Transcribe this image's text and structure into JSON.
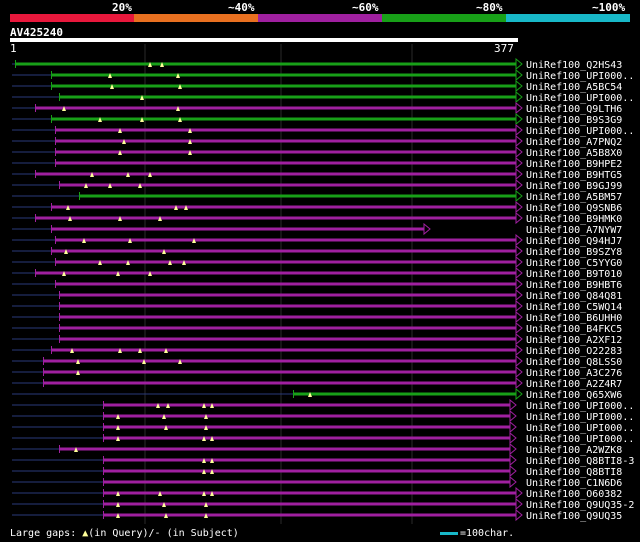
{
  "legend": {
    "segments": [
      {
        "color": "#e8183c"
      },
      {
        "color": "#e87020"
      },
      {
        "color": "#a020a0"
      },
      {
        "color": "#18a018"
      },
      {
        "color": "#18b8c8"
      }
    ],
    "labels": [
      "20%",
      "~40%",
      "~60%",
      "~80%",
      "~100%"
    ]
  },
  "query": {
    "name": "AV425240",
    "start": "1",
    "end": "377"
  },
  "hits": [
    {
      "label": "UniRef100_Q2HS43",
      "color": "green",
      "start": 16,
      "end": 516,
      "tris": [
        150,
        162
      ],
      "arrow": true
    },
    {
      "label": "UniRef100_UPI000..",
      "color": "green",
      "start": 52,
      "end": 516,
      "tris": [
        110,
        178
      ],
      "arrow": true
    },
    {
      "label": "UniRef100_A5BC54",
      "color": "green",
      "start": 52,
      "end": 516,
      "tris": [
        112,
        180
      ],
      "arrow": true
    },
    {
      "label": "UniRef100_UPI000..",
      "color": "green",
      "start": 60,
      "end": 516,
      "tris": [
        142
      ],
      "arrow": true
    },
    {
      "label": "UniRef100_Q9LTH6",
      "color": "purple",
      "start": 36,
      "end": 516,
      "tris": [
        64,
        178
      ],
      "arrow": true
    },
    {
      "label": "UniRef100_B9S3G9",
      "color": "green",
      "start": 52,
      "end": 516,
      "tris": [
        100,
        142,
        180
      ],
      "arrow": true
    },
    {
      "label": "UniRef100_UPI000..",
      "color": "purple",
      "start": 56,
      "end": 516,
      "tris": [
        120,
        190
      ],
      "arrow": true
    },
    {
      "label": "UniRef100_A7PNQ2",
      "color": "purple",
      "start": 56,
      "end": 516,
      "tris": [
        124,
        190
      ],
      "arrow": true
    },
    {
      "label": "UniRef100_A5B8X0",
      "color": "purple",
      "start": 56,
      "end": 516,
      "tris": [
        120,
        190
      ],
      "arrow": true
    },
    {
      "label": "UniRef100_B9HPE2",
      "color": "purple",
      "start": 56,
      "end": 516,
      "tris": [],
      "arrow": true
    },
    {
      "label": "UniRef100_B9HTG5",
      "color": "purple",
      "start": 36,
      "end": 516,
      "tris": [
        92,
        128,
        150
      ],
      "arrow": true
    },
    {
      "label": "UniRef100_B9GJ99",
      "color": "purple",
      "start": 60,
      "end": 516,
      "tris": [
        86,
        110,
        140
      ],
      "arrow": true
    },
    {
      "label": "UniRef100_A5BM57",
      "color": "green",
      "start": 80,
      "end": 516,
      "tris": [],
      "arrow": true
    },
    {
      "label": "UniRef100_Q9SNB6",
      "color": "purple",
      "start": 52,
      "end": 516,
      "tris": [
        68,
        176,
        186
      ],
      "arrow": true
    },
    {
      "label": "UniRef100_B9HMK0",
      "color": "purple",
      "start": 36,
      "end": 516,
      "tris": [
        70,
        120,
        160
      ],
      "arrow": true
    },
    {
      "label": "UniRef100_A7NYW7",
      "color": "purple",
      "start": 52,
      "end": 424,
      "tris": [],
      "arrow": true
    },
    {
      "label": "UniRef100_Q94HJ7",
      "color": "purple",
      "start": 56,
      "end": 516,
      "tris": [
        84,
        130,
        194
      ],
      "arrow": true
    },
    {
      "label": "UniRef100_B9SZY8",
      "color": "purple",
      "start": 52,
      "end": 516,
      "tris": [
        66,
        164
      ],
      "arrow": true
    },
    {
      "label": "UniRef100_C5YYG0",
      "color": "purple",
      "start": 56,
      "end": 516,
      "tris": [
        100,
        128,
        170,
        184
      ],
      "arrow": true
    },
    {
      "label": "UniRef100_B9T010",
      "color": "purple",
      "start": 36,
      "end": 516,
      "tris": [
        64,
        118,
        150
      ],
      "arrow": true
    },
    {
      "label": "UniRef100_B9HBT6",
      "color": "purple",
      "start": 56,
      "end": 516,
      "tris": [],
      "arrow": true
    },
    {
      "label": "UniRef100_Q84Q81",
      "color": "purple",
      "start": 60,
      "end": 516,
      "tris": [],
      "arrow": true
    },
    {
      "label": "UniRef100_C5WQ14",
      "color": "purple",
      "start": 60,
      "end": 516,
      "tris": [],
      "arrow": true
    },
    {
      "label": "UniRef100_B6UHH0",
      "color": "purple",
      "start": 60,
      "end": 516,
      "tris": [],
      "arrow": true
    },
    {
      "label": "UniRef100_B4FKC5",
      "color": "purple",
      "start": 60,
      "end": 516,
      "tris": [],
      "arrow": true
    },
    {
      "label": "UniRef100_A2XF12",
      "color": "purple",
      "start": 60,
      "end": 516,
      "tris": [],
      "arrow": true
    },
    {
      "label": "UniRef100_O22283",
      "color": "purple",
      "start": 52,
      "end": 516,
      "tris": [
        72,
        120,
        140,
        166
      ],
      "arrow": true
    },
    {
      "label": "UniRef100_Q8LSS0",
      "color": "purple",
      "start": 44,
      "end": 516,
      "tris": [
        78,
        144,
        180
      ],
      "arrow": true
    },
    {
      "label": "UniRef100_A3C276",
      "color": "purple",
      "start": 44,
      "end": 516,
      "tris": [
        78
      ],
      "arrow": true
    },
    {
      "label": "UniRef100_A2Z4R7",
      "color": "purple",
      "start": 44,
      "end": 516,
      "tris": [],
      "arrow": true
    },
    {
      "label": "UniRef100_Q65XW6",
      "color": "green",
      "start": 294,
      "end": 516,
      "tris": [
        310
      ],
      "arrow": true
    },
    {
      "label": "UniRef100_UPI000..",
      "color": "purple",
      "start": 104,
      "end": 510,
      "tris": [
        158,
        168,
        204,
        212
      ],
      "arrow": true
    },
    {
      "label": "UniRef100_UPI000..",
      "color": "purple",
      "start": 104,
      "end": 510,
      "tris": [
        118,
        164,
        206
      ],
      "arrow": true
    },
    {
      "label": "UniRef100_UPI000..",
      "color": "purple",
      "start": 104,
      "end": 510,
      "tris": [
        118,
        166,
        206
      ],
      "arrow": true
    },
    {
      "label": "UniRef100_UPI000..",
      "color": "purple",
      "start": 104,
      "end": 510,
      "tris": [
        118,
        204,
        212
      ],
      "arrow": true
    },
    {
      "label": "UniRef100_A2WZK8",
      "color": "purple",
      "start": 60,
      "end": 510,
      "tris": [
        76
      ],
      "arrow": true
    },
    {
      "label": "UniRef100_Q8BTI8-3",
      "color": "purple",
      "start": 104,
      "end": 510,
      "tris": [
        204,
        212
      ],
      "arrow": true
    },
    {
      "label": "UniRef100_Q8BTI8",
      "color": "purple",
      "start": 104,
      "end": 510,
      "tris": [
        204,
        212
      ],
      "arrow": true
    },
    {
      "label": "UniRef100_C1N6D6",
      "color": "purple",
      "start": 104,
      "end": 510,
      "tris": [],
      "arrow": true
    },
    {
      "label": "UniRef100_O60382",
      "color": "purple",
      "start": 104,
      "end": 516,
      "tris": [
        118,
        160,
        204,
        212
      ],
      "arrow": true
    },
    {
      "label": "UniRef100_Q9UQ35-2",
      "color": "purple",
      "start": 104,
      "end": 516,
      "tris": [
        118,
        164,
        206
      ],
      "arrow": true
    },
    {
      "label": "UniRef100_Q9UQ35",
      "color": "purple",
      "start": 104,
      "end": 516,
      "tris": [
        118,
        166,
        206
      ],
      "arrow": true
    }
  ],
  "colors": {
    "green": "#18a018",
    "purple": "#a020a0",
    "triangle": "#ffff99",
    "gap": "#2a3a7a",
    "grid": "#2a2a2a",
    "scale": "#18b8c8"
  },
  "footer": {
    "prefix": "Large gaps: ",
    "query_part": "(in Query)/",
    "dash": "-",
    "subject_part": " (in Subject)",
    "scale_text": "=100char."
  }
}
